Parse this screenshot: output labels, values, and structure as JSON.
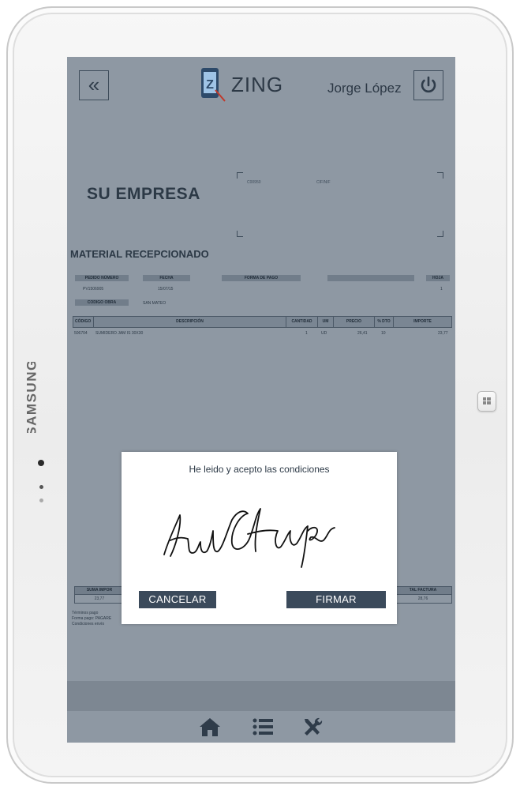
{
  "device": {
    "brand": "SAMSUNG"
  },
  "header": {
    "back_icon": "«",
    "app_name": "ZING",
    "user": "Jorge López"
  },
  "document": {
    "company": "SU EMPRESA",
    "cif_left": "C00950",
    "cif_right": "CIF/NIF",
    "title": "MATERIAL RECEPCIONADO",
    "order_headers": [
      "PEDIDO NÚMERO",
      "FECHA",
      "FORMA DE PAGO",
      "",
      "HOJA"
    ],
    "order_values": {
      "pedido": "PV1506905",
      "fecha": "15/07/15",
      "hoja": "1"
    },
    "obra_label": "CODIGO OBRA",
    "obra_value": "SAN MATEO",
    "columns": [
      "CÓDIGO",
      "DESCRIPCIÓN",
      "CANTIDAD",
      "UM",
      "PRECIO",
      "% DTO",
      "IMPORTE"
    ],
    "rows": [
      {
        "codigo": "506704",
        "descripcion": "SUMIDERO JAM IS 30X30",
        "cantidad": "1",
        "um": "UD",
        "precio": "26,41",
        "dto": "10",
        "importe": "23,77"
      }
    ],
    "totals": {
      "suma_label": "SUMA IMPOR",
      "suma_value": "23,77",
      "total_label": "TAL FACTURA",
      "total_value": "28,76"
    },
    "terms": [
      "Términos pago",
      "Forma pago: PAGARE",
      "Condiciones envío"
    ]
  },
  "dialog": {
    "title": "He leido y acepto las condiciones",
    "cancel": "CANCELAR",
    "sign": "FIRMAR"
  },
  "colors": {
    "screen": "#8e98a3",
    "button": "#3b4a5b",
    "text": "#2c3946"
  }
}
